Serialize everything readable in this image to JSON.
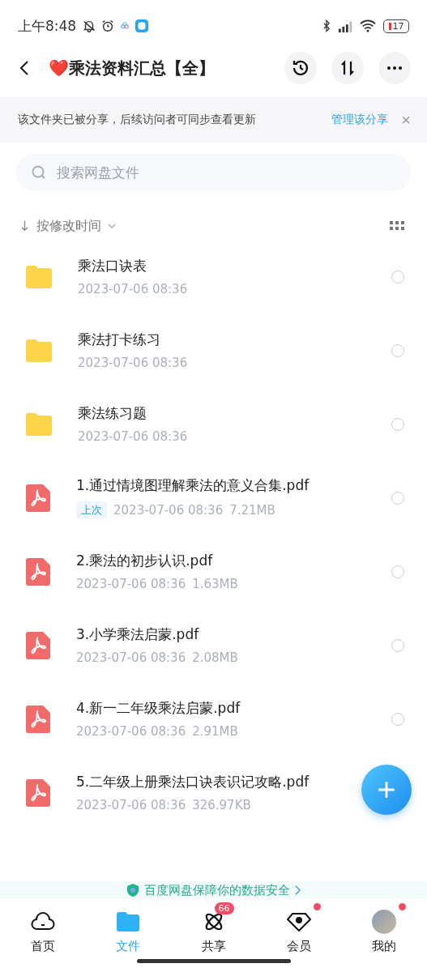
{
  "status_bar": {
    "time": "上午8:48",
    "battery": "17"
  },
  "header": {
    "title": "❤️乘法资料汇总【全】"
  },
  "share_notice": {
    "text": "该文件夹已被分享，后续访问者可同步查看更新",
    "action": "管理该分享",
    "close": "×"
  },
  "search": {
    "placeholder": "搜索网盘文件"
  },
  "sort": {
    "label": "按修改时间"
  },
  "files": [
    {
      "kind": "folder",
      "name": "乘法口诀表",
      "date": "2023-07-06  08:36",
      "selected": false
    },
    {
      "kind": "folder",
      "name": "乘法打卡练习",
      "date": "2023-07-06  08:36",
      "selected": false
    },
    {
      "kind": "folder",
      "name": "乘法练习题",
      "date": "2023-07-06  08:36",
      "selected": false
    },
    {
      "kind": "pdf",
      "name": "1.通过情境图理解乘法的意义合集.pdf",
      "tag": "上次",
      "date": "2023-07-06  08:36",
      "size": "7.21MB",
      "selected": false
    },
    {
      "kind": "pdf",
      "name": "2.乘法的初步认识.pdf",
      "date": "2023-07-06  08:36",
      "size": "1.63MB",
      "selected": false
    },
    {
      "kind": "pdf",
      "name": "3.小学乘法启蒙.pdf",
      "date": "2023-07-06  08:36",
      "size": "2.08MB",
      "selected": false
    },
    {
      "kind": "pdf",
      "name": "4.新一二年级乘法启蒙.pdf",
      "date": "2023-07-06  08:36",
      "size": "2.91MB",
      "selected": false
    },
    {
      "kind": "pdf",
      "name": "5.二年级上册乘法口诀表识记攻略.pdf",
      "date": "2023-07-06  08:36",
      "size": "326.97KB"
    }
  ],
  "security_banner": {
    "text": "百度网盘保障你的数据安全"
  },
  "tabs": [
    {
      "kind": "home",
      "label": "首页",
      "selected": false
    },
    {
      "kind": "files",
      "label": "文件",
      "selected": true
    },
    {
      "kind": "share",
      "label": "共享",
      "selected": false,
      "badge": "66"
    },
    {
      "kind": "vip",
      "label": "会员",
      "selected": false,
      "dot": true
    },
    {
      "kind": "me",
      "label": "我的",
      "selected": false,
      "dot": true
    }
  ]
}
